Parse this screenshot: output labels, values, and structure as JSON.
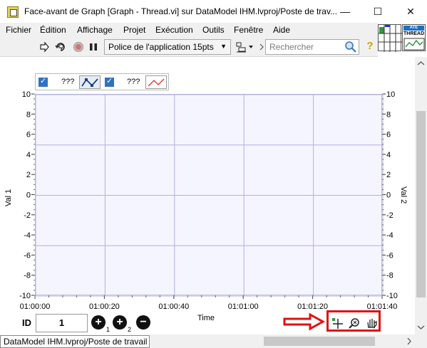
{
  "window": {
    "title": "Face-avant de Graph [Graph - Thread.vi] sur DataModel IHM.lvproj/Poste de trav...",
    "minimize": "—",
    "maximize": "☐",
    "close": "✕"
  },
  "menu": [
    "Fichier",
    "Édition",
    "Affichage",
    "Projet",
    "Exécution",
    "Outils",
    "Fenêtre",
    "Aide"
  ],
  "toolbar": {
    "font_select": "Police de l'application 15pts",
    "search_placeholder": "Rechercher",
    "help": "?"
  },
  "vi_icon": {
    "line1": "ATE",
    "line2": "THREAD"
  },
  "legend": {
    "plot1_label": "???",
    "plot2_label": "???"
  },
  "chart_data": {
    "type": "line",
    "series": [],
    "x_tick_labels": [
      "01:00:00",
      "01:00:20",
      "01:00:40",
      "01:01:00",
      "01:01:20",
      "01:01:40"
    ],
    "xlabel": "Time",
    "ylabel": "Val 1",
    "ylabel_right": "Val 2",
    "ylim": [
      -10,
      10
    ],
    "y_ticks": [
      "10",
      "8",
      "6",
      "4",
      "2",
      "0",
      "-2",
      "-4",
      "-6",
      "-8",
      "-10"
    ],
    "grid": true
  },
  "controls": {
    "id_label": "ID",
    "id_value": "1",
    "add1_sub": "1",
    "add2_sub": "2"
  },
  "status_bar": "DataModel IHM.lvproj/Poste de travail"
}
